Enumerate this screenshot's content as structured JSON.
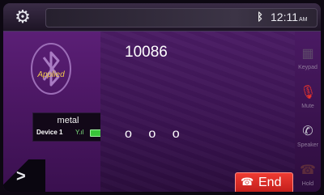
{
  "status_bar": {
    "settings_icon": "gear-icon",
    "bluetooth_icon": "bluetooth-icon",
    "time": "12:11",
    "ampm": "AM"
  },
  "left_panel": {
    "bluetooth_logo_icon": "bluetooth-logo-icon",
    "status_text": "Applied",
    "device_name": "metal",
    "device_label": "Device 1",
    "signal_icon": "signal-bars-icon",
    "battery_icon": "battery-icon",
    "expand_icon": "chevron-right-icon"
  },
  "call": {
    "number": "10086",
    "dots": "o o o",
    "end_label": "End",
    "end_icon": "hang-up-icon"
  },
  "side_menu": [
    {
      "label": "Keypad",
      "icon": "keypad-icon",
      "active": false
    },
    {
      "label": "Mute",
      "icon": "microphone-icon",
      "active": true
    },
    {
      "label": "Speaker",
      "icon": "speaker-icon",
      "active": true
    },
    {
      "label": "Hold",
      "icon": "phone-hold-icon",
      "active": false
    }
  ],
  "colors": {
    "accent_red": "#e8332c",
    "text_yellow": "#f2c94c",
    "panel_purple": "#4b1763"
  }
}
